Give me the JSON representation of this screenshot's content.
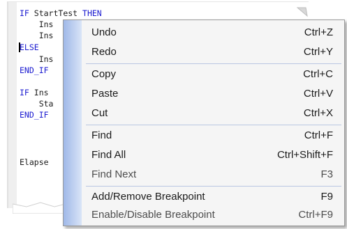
{
  "editor": {
    "lines": [
      {
        "kw": "IF",
        "text": " StartTest ",
        "kw2": "THEN"
      },
      {
        "kw": "",
        "text": "    Ins",
        "kw2": ""
      },
      {
        "kw": "",
        "text": "    Ins",
        "kw2": ""
      },
      {
        "kw": "ELSE",
        "text": "",
        "kw2": ""
      },
      {
        "kw": "",
        "text": "    Ins",
        "kw2": ""
      },
      {
        "kw": "END_IF",
        "text": "",
        "kw2": ""
      },
      {
        "kw": "",
        "text": "",
        "kw2": ""
      },
      {
        "kw": "IF",
        "text": " Ins",
        "kw2": ""
      },
      {
        "kw": "",
        "text": "    Sta",
        "kw2": ""
      },
      {
        "kw": "END_IF",
        "text": "",
        "kw2": ""
      },
      {
        "kw": "",
        "text": "",
        "kw2": ""
      },
      {
        "kw": "",
        "text": "",
        "kw2": ""
      },
      {
        "kw": "",
        "text": "",
        "kw2": ""
      },
      {
        "kw": "",
        "text": "Elapse",
        "kw2": ""
      }
    ],
    "keyword_color": "#1a1ad0"
  },
  "menu": {
    "items": [
      {
        "label": "Undo",
        "shortcut": "Ctrl+Z",
        "enabled": true
      },
      {
        "label": "Redo",
        "shortcut": "Ctrl+Y",
        "enabled": true
      },
      {
        "label": "Copy",
        "shortcut": "Ctrl+C",
        "enabled": true
      },
      {
        "label": "Paste",
        "shortcut": "Ctrl+V",
        "enabled": true
      },
      {
        "label": "Cut",
        "shortcut": "Ctrl+X",
        "enabled": true
      },
      {
        "label": "Find",
        "shortcut": "Ctrl+F",
        "enabled": true
      },
      {
        "label": "Find All",
        "shortcut": "Ctrl+Shift+F",
        "enabled": true
      },
      {
        "label": "Find Next",
        "shortcut": "F3",
        "enabled": false
      },
      {
        "label": "Add/Remove Breakpoint",
        "shortcut": "F9",
        "enabled": true
      },
      {
        "label": "Enable/Disable Breakpoint",
        "shortcut": "Ctrl+F9",
        "enabled": false
      }
    ],
    "strip_color": "#9fb8e8"
  }
}
